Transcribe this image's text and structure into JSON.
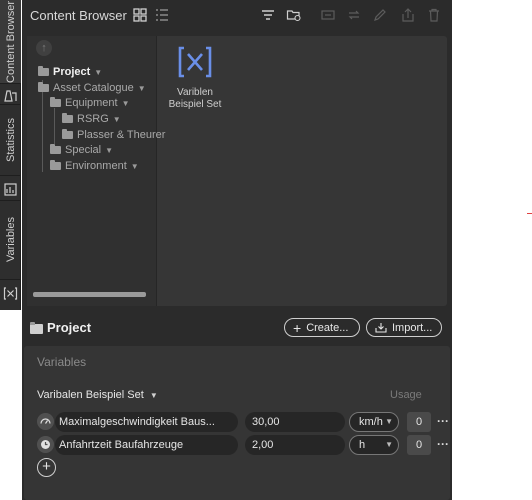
{
  "rail": {
    "tabs": [
      {
        "label": "Content Browser",
        "icon": "content-browser-icon"
      },
      {
        "label": "Statistics",
        "icon": "statistics-icon"
      },
      {
        "label": "Variables",
        "icon": "variables-icon"
      }
    ]
  },
  "header": {
    "title": "Content Browser",
    "icons": [
      "grid-view-icon",
      "list-view-icon",
      "filter-icon",
      "settings-folder-icon",
      "rename-icon",
      "replace-icon",
      "edit-icon",
      "export-icon",
      "delete-icon"
    ]
  },
  "tree": {
    "items": [
      {
        "label": "Project",
        "level": 0
      },
      {
        "label": "Asset Catalogue",
        "level": 0
      },
      {
        "label": "Equipment",
        "level": 1
      },
      {
        "label": "RSRG",
        "level": 2
      },
      {
        "label": "Plasser & Theurer",
        "level": 2
      },
      {
        "label": "Special",
        "level": 1
      },
      {
        "label": "Environment",
        "level": 1
      }
    ]
  },
  "asset": {
    "line1": "Variblen",
    "line2": "Beispiel Set",
    "icon": "variable-set-icon"
  },
  "project_bar": {
    "title": "Project",
    "create_label": "Create...",
    "import_label": "Import..."
  },
  "variables": {
    "title": "Variables",
    "set_name": "Varibalen Beispiel Set",
    "usage_header": "Usage",
    "rows": [
      {
        "name": "Maximalgeschwindigkeit Baus...",
        "value": "30,00",
        "unit": "km/h",
        "usage": "0",
        "icon": "speedometer-icon"
      },
      {
        "name": "Anfahrtzeit Baufahrzeuge",
        "value": "2,00",
        "unit": "h",
        "usage": "0",
        "icon": "clock-icon"
      }
    ]
  },
  "colors": {
    "panel": "#2b2b2b",
    "accent": "#6a8fe8"
  }
}
